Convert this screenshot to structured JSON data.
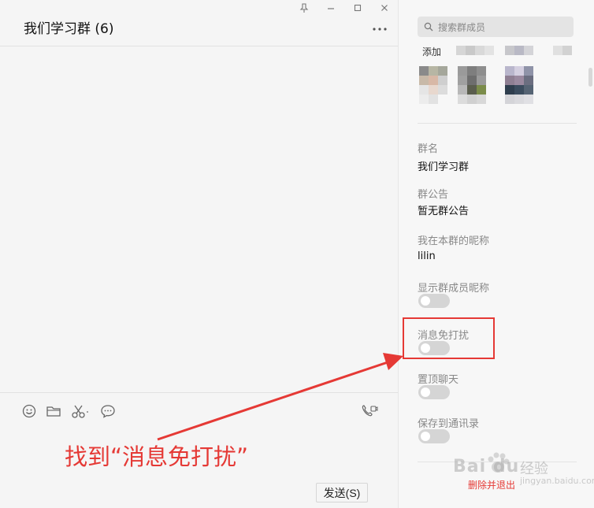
{
  "chat": {
    "title": "我们学习群 (6)",
    "send_label": "发送(S)"
  },
  "annotation": {
    "text": "找到“消息免打扰”",
    "color": "#e53935"
  },
  "panel": {
    "search_placeholder": "搜索群成员",
    "add_label": "添加",
    "group_name_label": "群名",
    "group_name_value": "我们学习群",
    "announcement_label": "群公告",
    "announcement_value": "暂无群公告",
    "nickname_label": "我在本群的昵称",
    "nickname_value": "lilin",
    "show_nicknames_label": "显示群成员昵称",
    "mute_label": "消息免打扰",
    "pin_label": "置顶聊天",
    "save_contacts_label": "保存到通讯录",
    "delete_label": "删除并退出",
    "toggles": {
      "show_nicknames": false,
      "mute": false,
      "pin": false,
      "save_contacts": false
    }
  },
  "icons": {
    "window_controls": [
      "pin-icon",
      "minimize-icon",
      "maximize-icon",
      "close-icon"
    ],
    "toolbar": [
      "emoji-icon",
      "folder-icon",
      "scissors-icon",
      "chat-bubble-icon",
      "video-call-icon"
    ],
    "search": "search-icon",
    "more": "more-icon"
  },
  "watermark": {
    "logo": "Bai du",
    "subtitle": "经验",
    "url": "jingyan.baidu.com"
  },
  "colors": {
    "accent_red": "#e53935",
    "toggle_off": "#d5d5d5",
    "panel_bg": "#f7f7f7",
    "chat_bg": "#f5f5f5"
  }
}
